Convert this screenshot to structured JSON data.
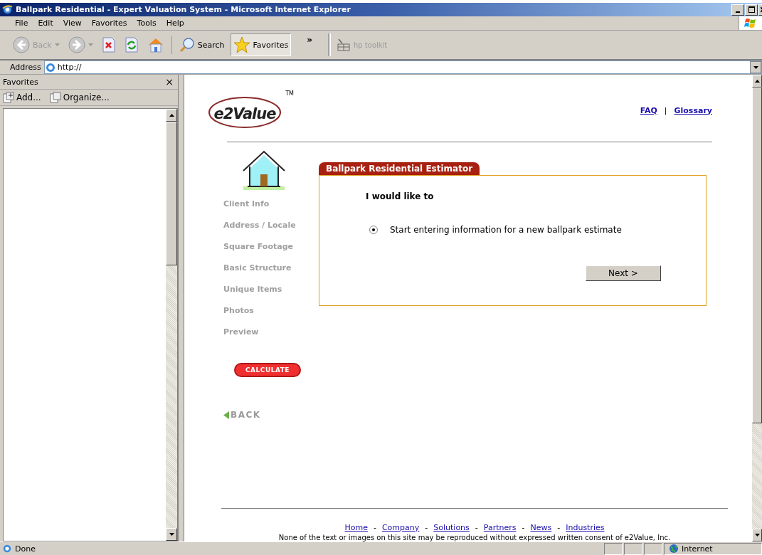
{
  "window": {
    "title": "Ballpark Residential - Expert Valuation System - Microsoft Internet Explorer"
  },
  "menu": [
    "File",
    "Edit",
    "View",
    "Favorites",
    "Tools",
    "Help"
  ],
  "toolbar": [
    {
      "kind": "back",
      "label": "Back",
      "disabled": true,
      "pressed": false
    },
    {
      "kind": "forward",
      "disabled": true,
      "pressed": false
    },
    {
      "kind": "stop",
      "pressed": false
    },
    {
      "kind": "refresh",
      "pressed": false
    },
    {
      "kind": "home",
      "pressed": false
    },
    {
      "kind": "search",
      "label": "Search",
      "pressed": false
    },
    {
      "kind": "favorites",
      "label": "Favorites",
      "pressed": true
    }
  ],
  "toolbar_more": "»",
  "extra_toolbar": {
    "label": "hp toolkit",
    "disabled": true
  },
  "address": {
    "label": "Address",
    "value": "http://"
  },
  "favorites_panel": {
    "title": "Favorites",
    "close": "×",
    "actions": [
      {
        "kind": "add",
        "label": "Add..."
      },
      {
        "kind": "organize",
        "label": "Organize..."
      }
    ]
  },
  "page": {
    "logo": {
      "text": "e2Value",
      "mark": "TM"
    },
    "top_links": [
      "FAQ",
      "Glossary"
    ],
    "top_separator": "|",
    "steps": [
      "Client Info",
      "Address / Locale",
      "Square Footage",
      "Basic Structure",
      "Unique Items",
      "Photos",
      "Preview"
    ],
    "calculate": "CALCULATE",
    "back": "BACK",
    "panel": {
      "title": "Ballpark Residential Estimator",
      "prompt": "I would like to",
      "options": [
        {
          "label": "Start entering information for a new ballpark estimate",
          "selected": true
        }
      ],
      "next": "Next >"
    },
    "footer_links": [
      "Home",
      "Company",
      "Solutions",
      "Partners",
      "News",
      "Industries"
    ],
    "footer_separator": "-",
    "copyright": "None of the text or images on this site may be reproduced without expressed written consent of e2Value, Inc."
  },
  "status_bar": {
    "text": "Done",
    "zone": "Internet"
  }
}
